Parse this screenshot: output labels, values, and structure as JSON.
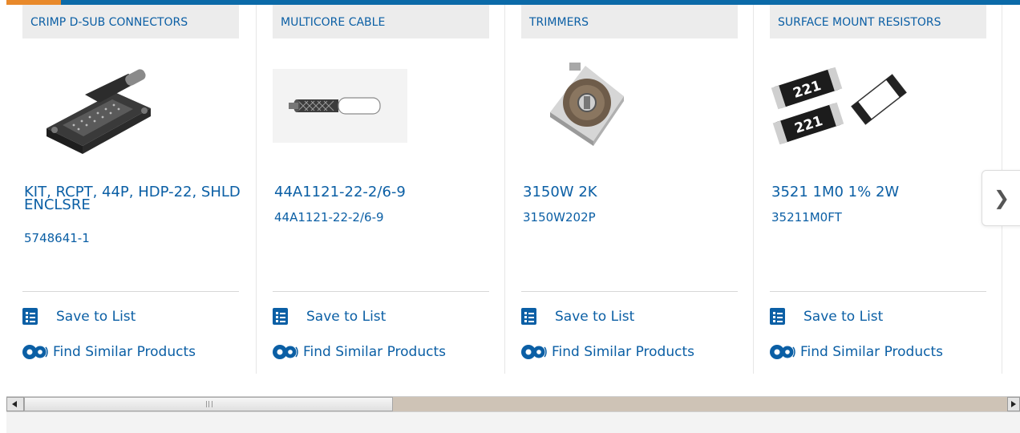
{
  "products": [
    {
      "category": "CRIMP D-SUB CONNECTORS",
      "title": "KIT, RCPT, 44P, HDP-22, SHLD ENCLSRE",
      "part_number": "5748641-1",
      "image_icon": "dsub-connector-image"
    },
    {
      "category": "MULTICORE CABLE",
      "title": "44A1121-22-2/6-9",
      "part_number": "44A1121-22-2/6-9",
      "image_icon": "cable-image"
    },
    {
      "category": "TRIMMERS",
      "title": "3150W 2K",
      "part_number": "3150W202P",
      "image_icon": "trimmer-image"
    },
    {
      "category": "SURFACE MOUNT RESISTORS",
      "title": "3521 1M0 1% 2W",
      "part_number": "35211M0FT",
      "image_icon": "smd-resistor-image",
      "resistor_marking": "221"
    }
  ],
  "actions": {
    "save_label": "Save to List",
    "similar_label": "Find Similar Products"
  },
  "colors": {
    "brand_blue": "#0b5fa5",
    "accent_orange": "#e8892b",
    "tab_gray": "#ececec"
  },
  "next_icon": "chevron-right-icon"
}
